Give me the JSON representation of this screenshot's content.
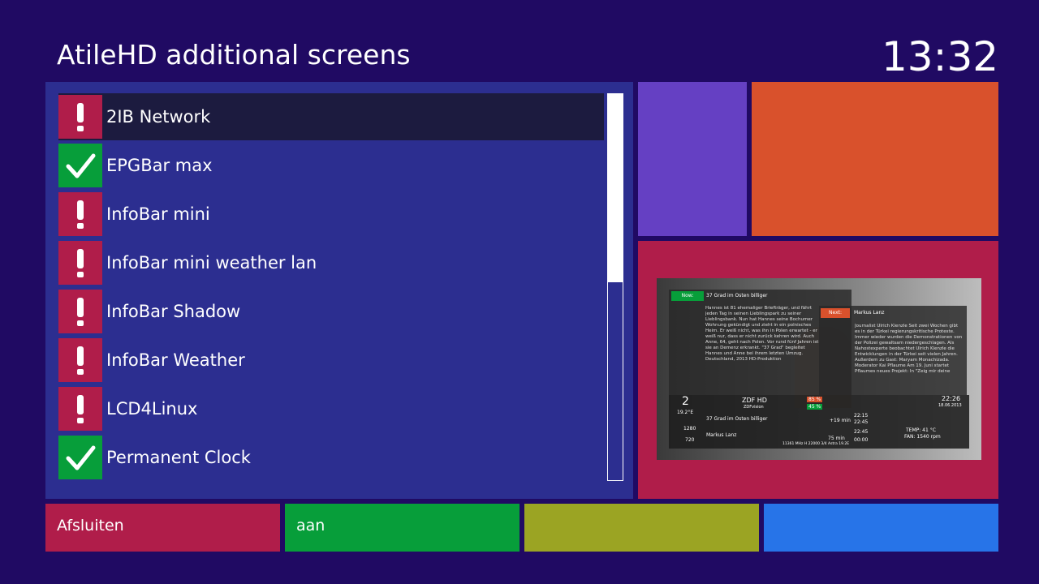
{
  "header": {
    "title": "AtileHD additional screens",
    "clock": "13:32"
  },
  "list": {
    "items": [
      {
        "label": "2IB Network",
        "status": "disabled",
        "icon": "exclamation-icon",
        "selected": true
      },
      {
        "label": "EPGBar max",
        "status": "enabled",
        "icon": "checkmark-icon",
        "selected": false
      },
      {
        "label": "InfoBar mini",
        "status": "disabled",
        "icon": "exclamation-icon",
        "selected": false
      },
      {
        "label": "InfoBar mini weather lan",
        "status": "disabled",
        "icon": "exclamation-icon",
        "selected": false
      },
      {
        "label": "InfoBar Shadow",
        "status": "disabled",
        "icon": "exclamation-icon",
        "selected": false
      },
      {
        "label": "InfoBar Weather",
        "status": "disabled",
        "icon": "exclamation-icon",
        "selected": false
      },
      {
        "label": "LCD4Linux",
        "status": "disabled",
        "icon": "exclamation-icon",
        "selected": false
      },
      {
        "label": "Permanent Clock",
        "status": "enabled",
        "icon": "checkmark-icon",
        "selected": false
      }
    ],
    "scroll_fraction_visible": 0.487
  },
  "preview": {
    "now_tag": "Now:",
    "now_title": "37 Grad im Osten billiger",
    "now_text": "Hannes ist 81 ehemaliger Briefträger, und fährt jeden Tag in seinen Lieblingspark zu seiner Lieblingsbank. Nun hat Hannes seine Bochumer Wohnung gekündigt und zieht in ein polnisches Heim. Er weiß nicht, was ihn in Polen erwartet - er weiß nur, dass er nicht zurück kehren wird. Auch Anne, 64, geht nach Polen. Vor rund fünf Jahren ist sie an Demenz erkrankt. \"37 Grad\" begleitet Hannes und Anne bei ihrem letzten Umzug. Deutschland, 2013 HD-Produktion",
    "next_tag": "Next:",
    "next_title": "Markus Lanz",
    "next_text": "Journalist Ulrich Kienzle Seit zwei Wochen gibt es in der Türkei regierungskritische Proteste. Immer wieder wurden die Demonstrationen von der Polizei gewaltsam niedergeschlagen. Als Nahostexperte beobachtet Ulrich Kienzle die Entwicklungen in der Türkei seit vielen Jahren. Außerdem zu Gast: Maryam Monachizada. Moderator Kai Pflaume Am 19. Juni startet Pflaumes neues Projekt: In \"Zeig mir deine",
    "channel_number": "2",
    "sat_position": "19.2°E",
    "channel_name": "ZDF HD",
    "channel_sub": "ZDFvision",
    "event1_title": "37 Grad im Osten billiger",
    "event1_remaining": "+19 min",
    "event2_title": "Markus Lanz",
    "event2_duration": "75 min",
    "time1": "22:15",
    "time2": "22:45",
    "time3": "22:45",
    "time4": "00:00",
    "resolution_w": "1280",
    "resolution_h": "720",
    "clock": "22:26",
    "date": "18.06.2013",
    "signal1": "85 %",
    "signal2": "45 %",
    "temp": "TEMP: 41 °C",
    "fan": "FAN: 1540 rpm",
    "footer_line": "11361 MHz H 22000 3/4 Astra 19.2E"
  },
  "keys": {
    "red": "Afsluiten",
    "green": "aan",
    "yellow": "",
    "blue": ""
  },
  "colors": {
    "background": "#200a63",
    "panel": "#2c2e90",
    "selection": "#1c1b3f",
    "warn": "#b01d4a",
    "ok": "#079e3a",
    "tile_purple": "#6540c3",
    "tile_orange": "#d9512c",
    "key_red": "#b01d4a",
    "key_green": "#079e3a",
    "key_yellow": "#9ba423",
    "key_blue": "#2774e8"
  }
}
